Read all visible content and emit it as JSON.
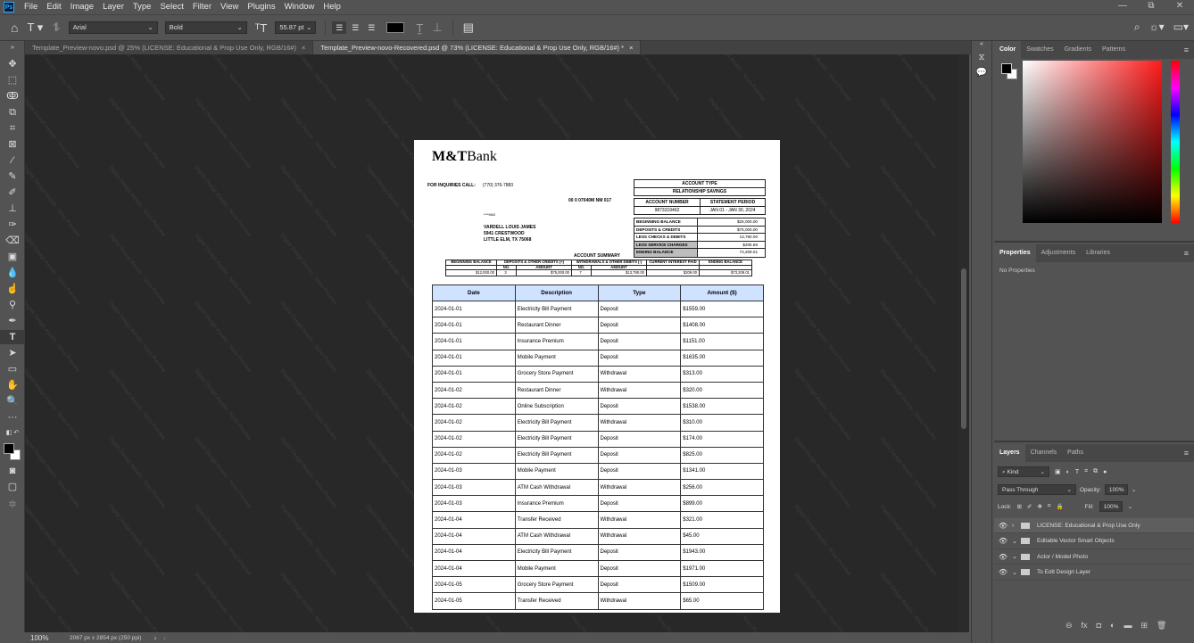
{
  "app": {
    "menus": [
      "File",
      "Edit",
      "Image",
      "Layer",
      "Type",
      "Select",
      "Filter",
      "View",
      "Plugins",
      "Window",
      "Help"
    ],
    "window_controls": [
      "—",
      "⧉",
      "✕"
    ]
  },
  "options_bar": {
    "font_family": "Arial",
    "font_style": "Bold",
    "font_size": "55.87 pt",
    "text_color": "#000000"
  },
  "tabs": [
    {
      "label": "Template_Preview-novo.psd @ 25% (LICENSE: Educational & Prop Use Only, RGB/16#)",
      "active": false
    },
    {
      "label": "Template_Preview-novo-Recovered.psd @ 73% (LICENSE: Educational & Prop Use Only, RGB/16#) *",
      "active": true
    }
  ],
  "tab_close": "×",
  "watermark_text": "Digital Design Assets - Novo Preview",
  "document": {
    "bank_name_bold": "M&T",
    "bank_name_rest": "Bank",
    "inquiries_label": "FOR INQUIRIES CALL:",
    "inquiries_phone": "(770) 376-7883",
    "account_code": "00    0 07040M NM  017",
    "tiny_code": "****9462",
    "address_lines": [
      "VARDELL LOUIS JAMES",
      "5941 CRESTWOOD",
      "LITTLE ELM, TX 75068"
    ],
    "account_type_label": "ACCOUNT TYPE",
    "account_type_value": "RELATIONSHIP SAVINGS",
    "account_number_label": "ACCOUNT NUMBER",
    "statement_period_label": "STATEMENT PERIOD",
    "account_number": "9873319462",
    "statement_period": "JAN 01 - JAN 30, 2024",
    "balances": [
      {
        "label": "BEGINNING BALANCE",
        "value": "$25,000.00",
        "shaded": false
      },
      {
        "label": "DEPOSITS & CREDITS",
        "value": "$75,000.00",
        "shaded": false
      },
      {
        "label": "LESS CHECKS & DEBITS",
        "value": "13,790.00",
        "shaded": false
      },
      {
        "label": "LESS SERVICE CHARGES",
        "value": "$205.88",
        "shaded": true
      },
      {
        "label": "ENDING BALANCE",
        "value": "73,209.01",
        "shaded": true
      }
    ],
    "summary_title": "ACCOUNT SUMMARY",
    "summary_headers": {
      "beginning": "BEGINNING BALANCE",
      "deposits": "DEPOSITS & OTHER CREDITS (+)",
      "withdrawals": "WITHDRAWALS & OTHER DEBITS (-)",
      "interest": "CURRENT INTEREST PAID",
      "ending": "ENDING BALANCE",
      "no": "NO.",
      "amount": "AMOUNT"
    },
    "summary_values": {
      "beginning": "$12,000.00",
      "dep_no": "3",
      "dep_amount": "$75,000.00",
      "wd_no": "7",
      "wd_amount": "$13,790.00",
      "interest": "$209.00",
      "ending": "$73,209.01"
    },
    "transactions_headers": [
      "Date",
      "Description",
      "Type",
      "Amount ($)"
    ],
    "transactions": [
      [
        "2024-01-01",
        "Electricity Bill Payment",
        "Deposit",
        "$1559.00"
      ],
      [
        "2024-01-01",
        "Restaurant Dinner",
        "Deposit",
        "$1408.00"
      ],
      [
        "2024-01-01",
        "Insurance Premium",
        "Deposit",
        "$1151.00"
      ],
      [
        "2024-01-01",
        "Mobile Payment",
        "Deposit",
        "$1635.00"
      ],
      [
        "2024-01-01",
        "Grocery Store Payment",
        "Withdrawal",
        "$313.00"
      ],
      [
        "2024-01-02",
        "Restaurant Dinner",
        "Withdrawal",
        "$320.00"
      ],
      [
        "2024-01-02",
        "Online Subscription",
        "Deposit",
        "$1538.00"
      ],
      [
        "2024-01-02",
        "Electricity Bill Payment",
        "Withdrawal",
        "$310.00"
      ],
      [
        "2024-01-02",
        "Electricity Bill Payment",
        "Deposit",
        "$174.00"
      ],
      [
        "2024-01-02",
        "Electricity Bill Payment",
        "Deposit",
        "$825.00"
      ],
      [
        "2024-01-03",
        "Mobile Payment",
        "Deposit",
        "$1341.00"
      ],
      [
        "2024-01-03",
        "ATM Cash Withdrawal",
        "Withdrawal",
        "$256.00"
      ],
      [
        "2024-01-03",
        "Insurance Premium",
        "Deposit",
        "$899.00"
      ],
      [
        "2024-01-04",
        "Transfer Received",
        "Withdrawal",
        "$321.00"
      ],
      [
        "2024-01-04",
        "ATM Cash Withdrawal",
        "Withdrawal",
        "$45.00"
      ],
      [
        "2024-01-04",
        "Electricity Bill Payment",
        "Deposit",
        "$1943.00"
      ],
      [
        "2024-01-04",
        "Mobile Payment",
        "Deposit",
        "$1971.00"
      ],
      [
        "2024-01-05",
        "Grocery Store Payment",
        "Deposit",
        "$1509.00"
      ],
      [
        "2024-01-05",
        "Transfer Received",
        "Withdrawal",
        "$65.00"
      ]
    ]
  },
  "status_bar": {
    "zoom": "100%",
    "doc_info": "2067 px x 2854 px (250 ppi)"
  },
  "color_panel": {
    "tabs": [
      "Color",
      "Swatches",
      "Gradients",
      "Patterns"
    ]
  },
  "properties_panel": {
    "tabs": [
      "Properties",
      "Adjustments",
      "Libraries"
    ],
    "empty_text": "No Properties"
  },
  "layers_panel": {
    "tabs": [
      "Layers",
      "Channels",
      "Paths"
    ],
    "kind_label": "Kind",
    "blend_mode": "Pass Through",
    "opacity_label": "Opacity:",
    "opacity_value": "100%",
    "lock_label": "Lock:",
    "fill_label": "Fill:",
    "fill_value": "100%",
    "layers": [
      {
        "name": "LICENSE: Educational & Prop Use Only",
        "expanded": false
      },
      {
        "name": "Editable Vector Smart Objects",
        "expanded": true
      },
      {
        "name": "Actor / Model Photo",
        "expanded": true
      },
      {
        "name": "To Edit Design Layer",
        "expanded": true
      }
    ]
  }
}
